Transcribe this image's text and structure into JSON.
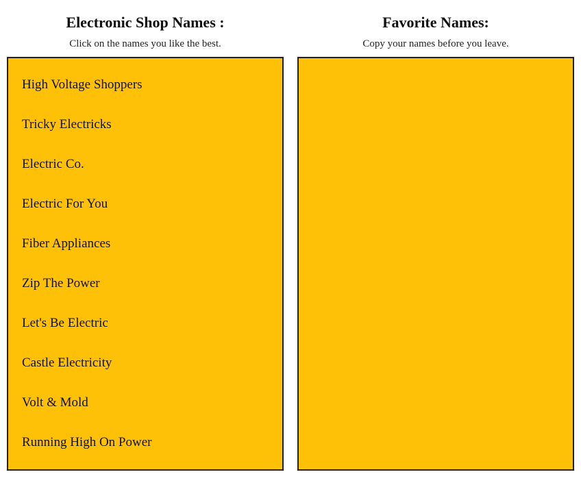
{
  "left_column": {
    "header": "Electronic Shop Names :",
    "subtext": "Click on the names you like the best.",
    "names": [
      "High Voltage Shoppers",
      "Tricky Electricks",
      "Electric Co.",
      "Electric For You",
      "Fiber Appliances",
      "Zip The Power",
      "Let's Be Electric",
      "Castle Electricity",
      "Volt & Mold",
      "Running High On Power"
    ]
  },
  "right_column": {
    "header": "Favorite Names:",
    "subtext": "Copy your names before you leave.",
    "names": []
  }
}
